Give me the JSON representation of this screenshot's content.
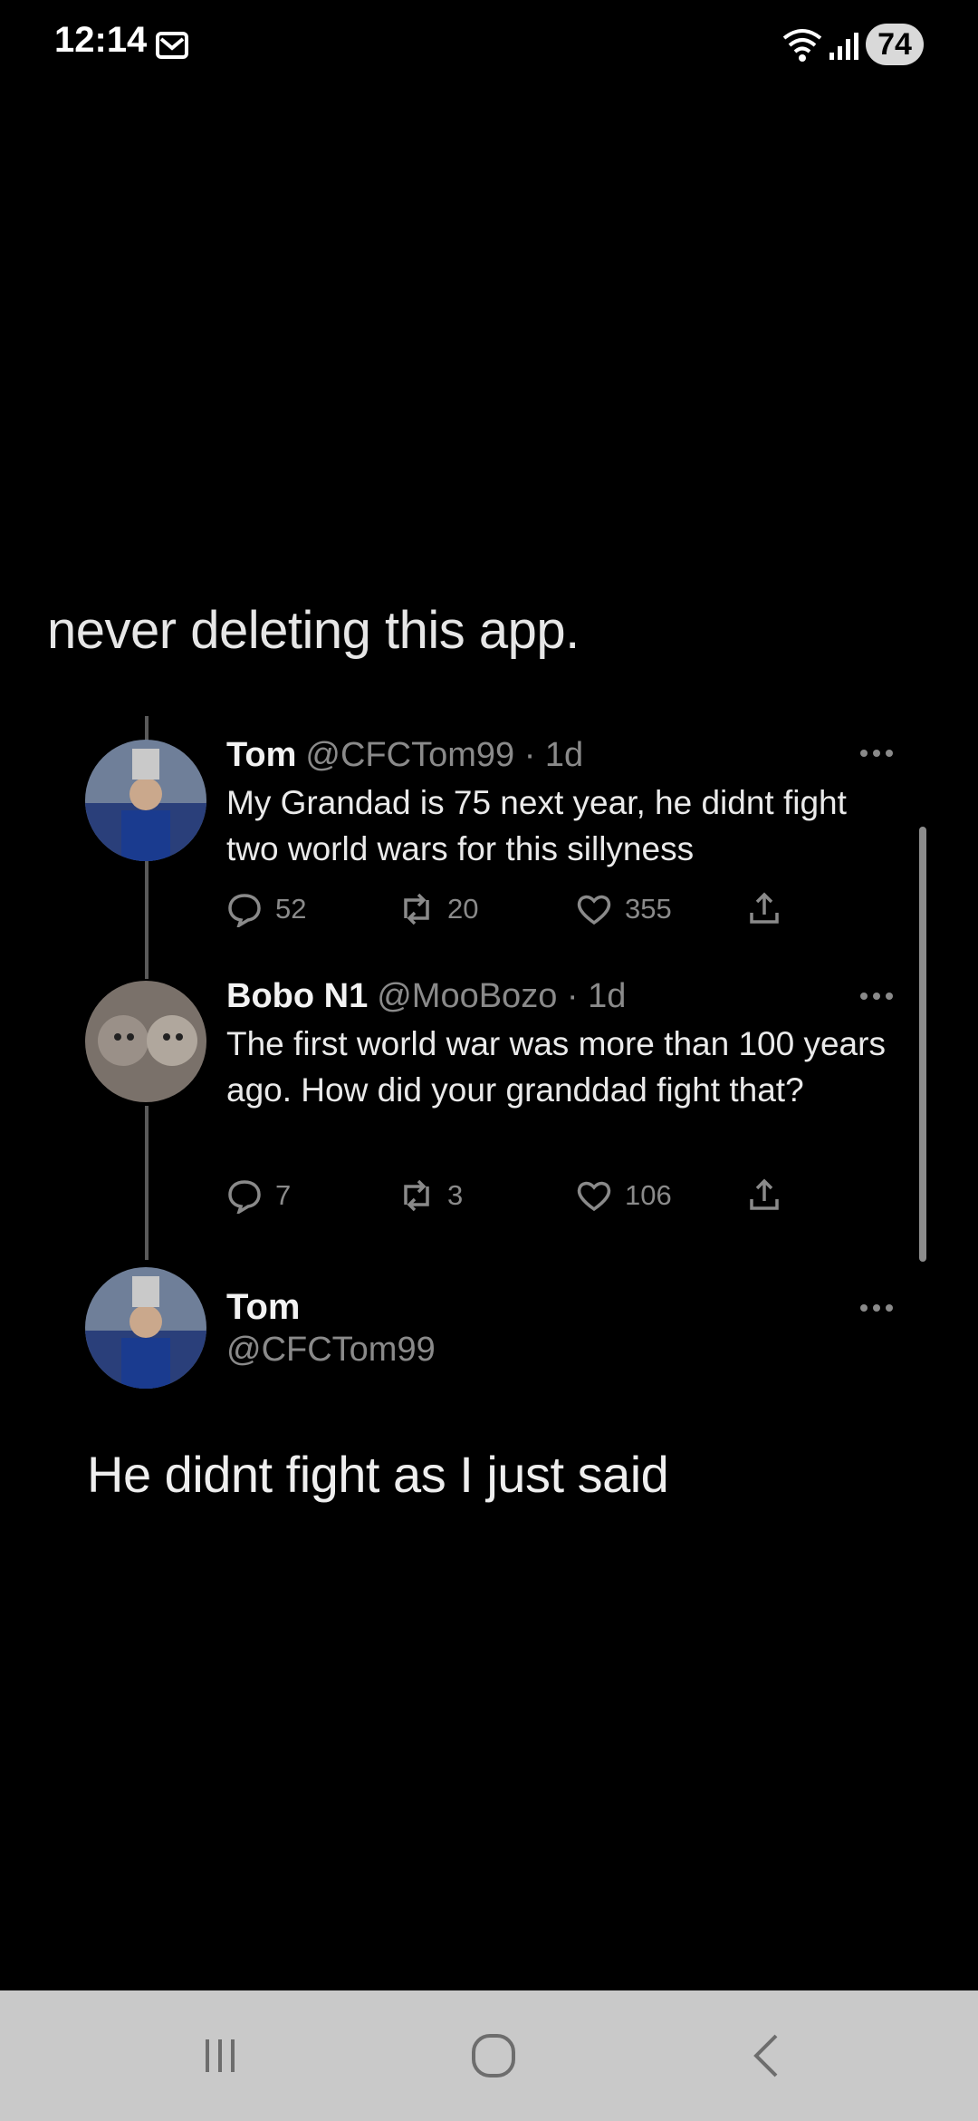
{
  "status_bar": {
    "time": "12:14",
    "battery": "74"
  },
  "caption": "never deleting this app.",
  "tweets": [
    {
      "name": "Tom",
      "handle": "@CFCTom99 · 1d",
      "text": "My Grandad is 75 next year,  he didnt fight two world wars for this sillyness",
      "replies": "52",
      "retweets": "20",
      "likes": "355"
    },
    {
      "name": "Bobo N1",
      "handle": "@MooBozo · 1d",
      "text": "The first world war was more than 100 years ago. How did your granddad fight that?",
      "replies": "7",
      "retweets": "3",
      "likes": "106"
    }
  ],
  "reply": {
    "name": "Tom",
    "handle": "@CFCTom99",
    "text": "He didnt fight as I just said"
  },
  "colors": {
    "background": "#000000",
    "nav_bar": "#c9c9c9",
    "muted_text": "#8a8a8a"
  },
  "icons": [
    "mail-icon",
    "wifi-icon",
    "signal-icon",
    "more-icon",
    "reply-icon",
    "retweet-icon",
    "like-icon",
    "share-icon",
    "recents-icon",
    "home-icon",
    "back-icon"
  ]
}
